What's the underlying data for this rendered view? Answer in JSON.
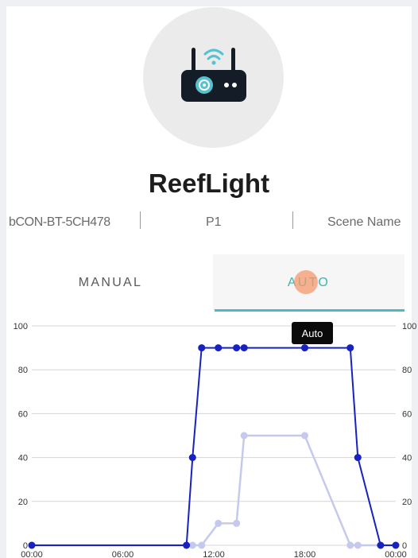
{
  "device": {
    "name": "ReefLight",
    "id": "bCON-BT-5CH478",
    "profile": "P1",
    "scene_label": "Scene Name",
    "icon": "router-wifi-icon"
  },
  "tabs": [
    {
      "label": "MANUAL",
      "active": false
    },
    {
      "label": "AUTO",
      "active": true
    }
  ],
  "colors": {
    "accent": "#3ab6b4",
    "series_primary": "#1722c0",
    "series_secondary": "#c6c9ee"
  },
  "tooltip": {
    "text": "Auto"
  },
  "chart_data": {
    "type": "line",
    "x_ticks": [
      "00:00",
      "06:00",
      "12:00",
      "18:00",
      "00:00"
    ],
    "y_ticks": [
      0,
      20,
      40,
      60,
      80,
      100
    ],
    "ylim": [
      0,
      100
    ],
    "xlim_hours": [
      0,
      24
    ],
    "grid": true,
    "series": [
      {
        "color": "#1722c0",
        "points": [
          [
            0,
            0
          ],
          [
            10.2,
            0
          ],
          [
            10.6,
            40
          ],
          [
            11.2,
            90
          ],
          [
            12.3,
            90
          ],
          [
            13.5,
            90
          ],
          [
            14,
            90
          ],
          [
            18,
            90
          ],
          [
            21,
            90
          ],
          [
            21.5,
            40
          ],
          [
            23,
            0
          ],
          [
            24,
            0
          ]
        ]
      },
      {
        "color": "#c6c9ee",
        "points": [
          [
            0,
            0
          ],
          [
            10.2,
            0
          ],
          [
            10.6,
            0
          ],
          [
            11.2,
            0
          ],
          [
            12.3,
            10
          ],
          [
            13.5,
            10
          ],
          [
            14,
            50
          ],
          [
            18,
            50
          ],
          [
            21,
            0
          ],
          [
            21.5,
            0
          ],
          [
            23,
            0
          ],
          [
            24,
            0
          ]
        ]
      }
    ]
  }
}
